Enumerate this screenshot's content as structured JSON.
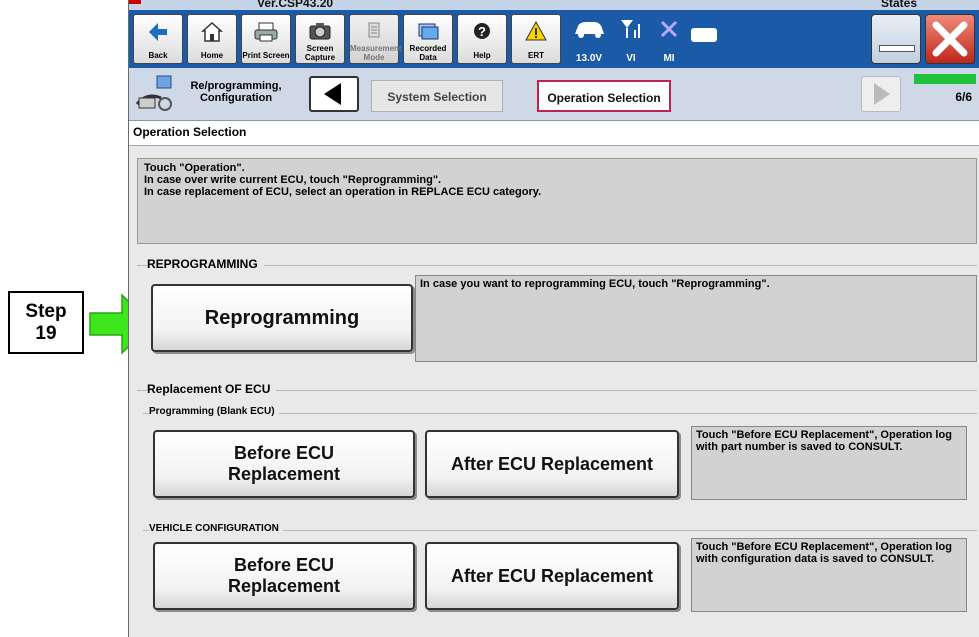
{
  "title_strip": {
    "version": "Ver.CSP43.20",
    "states": "States"
  },
  "toolbar": {
    "buttons": [
      {
        "label": "Back",
        "icon": "back-arrow-icon"
      },
      {
        "label": "Home",
        "icon": "home-icon"
      },
      {
        "label": "Print Screen",
        "icon": "printer-icon"
      },
      {
        "label": "Screen Capture",
        "icon": "camera-icon"
      },
      {
        "label": "Measurement Mode",
        "icon": "measurement-icon"
      },
      {
        "label": "Recorded Data",
        "icon": "recorded-data-icon"
      },
      {
        "label": "Help",
        "icon": "help-icon"
      },
      {
        "label": "ERT",
        "icon": "warning-icon"
      }
    ],
    "status": [
      {
        "label": "13.0V",
        "icon": "car-battery-icon"
      },
      {
        "label": "VI",
        "icon": "signal-icon"
      },
      {
        "label": "MI",
        "icon": "x-mark-icon"
      }
    ]
  },
  "navbar": {
    "section_label": "Re/programming, Configuration",
    "steps": [
      "System Selection",
      "Operation Selection"
    ],
    "progress_text": "6/6",
    "progress_fraction": 1.0
  },
  "page_header": "Operation Selection",
  "instructions": [
    "Touch \"Operation\".",
    "In case over write current ECU, touch \"Reprogramming\".",
    "In case replacement of ECU, select an operation in REPLACE ECU category."
  ],
  "reprogramming": {
    "title": "REPROGRAMMING",
    "button": "Reprogramming",
    "description": "In case you want to reprogramming ECU, touch \"Reprogramming\"."
  },
  "replacement": {
    "title": "Replacement OF ECU",
    "programming": {
      "title": "Programming (Blank ECU)",
      "before_line1": "Before ECU",
      "before_line2": "Replacement",
      "after": "After ECU Replacement",
      "description": "Touch \"Before ECU Replacement\", Operation log with part number is saved to CONSULT."
    },
    "vehicle_config": {
      "title": "VEHICLE CONFIGURATION",
      "before_line1": "Before ECU",
      "before_line2": "Replacement",
      "after": "After ECU Replacement",
      "description": "Touch \"Before ECU Replacement\", Operation log with configuration data is saved to CONSULT."
    }
  },
  "annotation": {
    "step_word": "Step",
    "step_number": "19",
    "arrow_color": "#3ee61e"
  }
}
